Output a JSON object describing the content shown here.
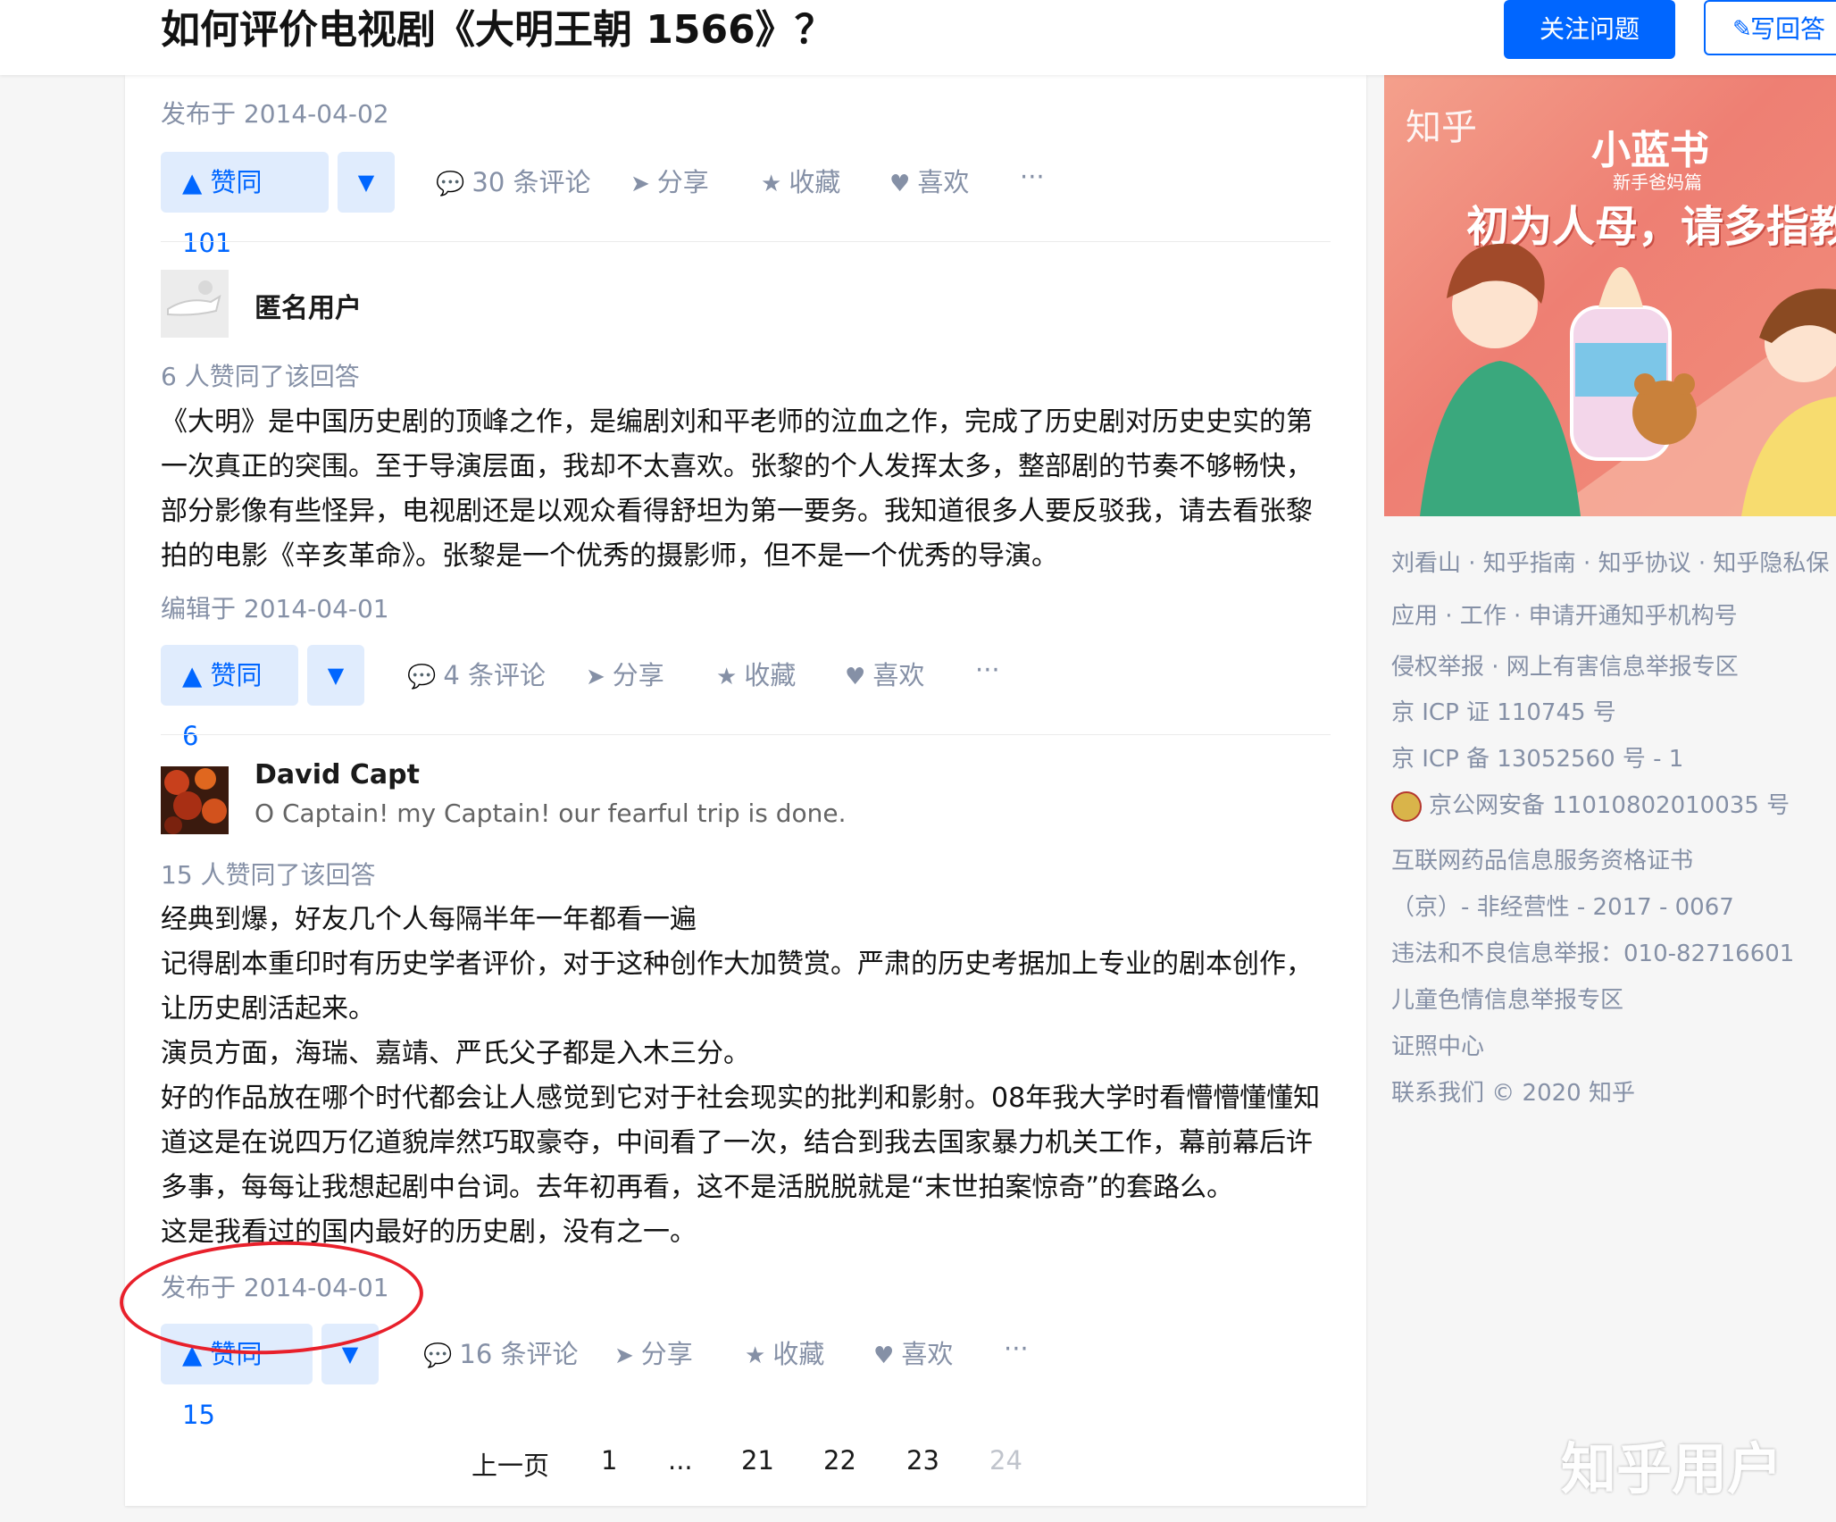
{
  "header": {
    "question_title": "如何评价电视剧《大明王朝 1566》？",
    "follow_label": "关注问题",
    "write_label": "写回答"
  },
  "answers": [
    {
      "published": "发布于 2014-04-02",
      "actions": {
        "vote": "赞同 101",
        "comments": "30 条评论",
        "share": "分享",
        "collect": "收藏",
        "like": "喜欢",
        "more": "···"
      }
    },
    {
      "author": "匿名用户",
      "upvote_count": "6 人赞同了该回答",
      "paragraphs": [
        "《大明》是中国历史剧的顶峰之作，是编剧刘和平老师的泣血之作，完成了历史剧对历史史实的第",
        "一次真正的突围。至于导演层面，我却不太喜欢。张黎的个人发挥太多，整部剧的节奏不够畅快，",
        "部分影像有些怪异，电视剧还是以观众看得舒坦为第一要务。我知道很多人要反驳我，请去看张黎",
        "拍的电影《辛亥革命》。张黎是一个优秀的摄影师，但不是一个优秀的导演。"
      ],
      "edited": "编辑于 2014-04-01",
      "actions": {
        "vote": "赞同 6",
        "comments": "4 条评论",
        "share": "分享",
        "collect": "收藏",
        "like": "喜欢",
        "more": "···"
      }
    },
    {
      "author": "David Capt",
      "bio": "O Captain! my Captain! our fearful trip is done.",
      "upvote_count": "15 人赞同了该回答",
      "paragraphs": [
        "经典到爆，好友几个人每隔半年一年都看一遍",
        "记得剧本重印时有历史学者评价，对于这种创作大加赞赏。严肃的历史考据加上专业的剧本创作，",
        "让历史剧活起来。",
        "演员方面，海瑞、嘉靖、严氏父子都是入木三分。",
        "好的作品放在哪个时代都会让人感觉到它对于社会现实的批判和影射。08年我大学时看懵懵懂懂知",
        "道这是在说四万亿道貌岸然巧取豪夺，中间看了一次，结合到我去国家暴力机关工作，幕前幕后许",
        "多事，每每让我想起剧中台词。去年初再看，这不是活脱脱就是“末世拍案惊奇”的套路么。",
        "这是我看过的国内最好的历史剧，没有之一。"
      ],
      "published": "发布于 2014-04-01",
      "actions": {
        "vote": "赞同 15",
        "comments": "16 条评论",
        "share": "分享",
        "collect": "收藏",
        "like": "喜欢",
        "more": "···"
      }
    }
  ],
  "pagination": {
    "prev": "上一页",
    "pages": [
      "1",
      "...",
      "21",
      "22",
      "23",
      "24"
    ]
  },
  "ad": {
    "brand": "知乎",
    "product": "小蓝书",
    "subtitle": "新手爸妈篇",
    "slogan": "初为人母，请多指教"
  },
  "sidebar_links": [
    "刘看山 · 知乎指南 · 知乎协议 · 知乎隐私保",
    "应用 · 工作 · 申请开通知乎机构号",
    "侵权举报 · 网上有害信息举报专区",
    "京 ICP 证 110745 号",
    "京 ICP 备 13052560 号 - 1",
    "京公网安备 11010802010035 号",
    "互联网药品信息服务资格证书",
    "（京）- 非经营性 - 2017 - 0067",
    "违法和不良信息举报：010-82716601",
    "儿童色情信息举报专区",
    "证照中心",
    "联系我们 © 2020 知乎"
  ],
  "watermark": "知乎用户",
  "colors": {
    "accent": "#0066ff",
    "annotation": "#e8202b"
  }
}
